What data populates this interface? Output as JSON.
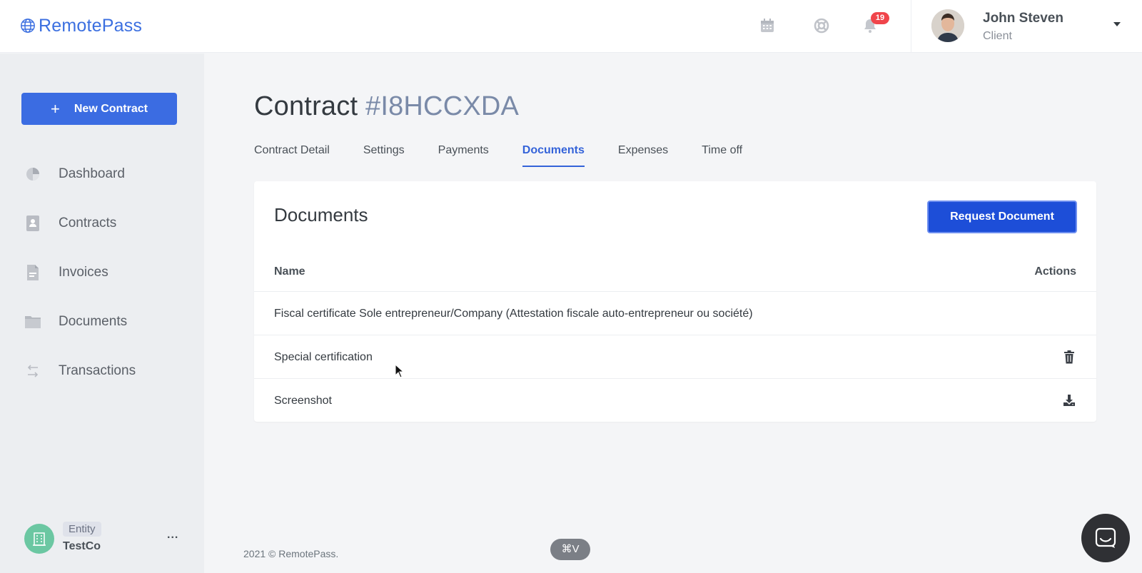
{
  "brand": {
    "name": "RemotePass",
    "color": "#3b6fe0"
  },
  "topbar": {
    "icons": [
      "calendar-icon",
      "support-icon",
      "bell-icon"
    ],
    "notification_count": "19",
    "user": {
      "name": "John Steven",
      "role": "Client"
    }
  },
  "sidebar": {
    "new_contract_label": "New Contract",
    "items": [
      {
        "label": "Dashboard",
        "icon": "pie-chart-icon"
      },
      {
        "label": "Contracts",
        "icon": "contract-icon"
      },
      {
        "label": "Invoices",
        "icon": "invoice-icon"
      },
      {
        "label": "Documents",
        "icon": "folder-icon"
      },
      {
        "label": "Transactions",
        "icon": "transfer-icon"
      }
    ],
    "entity": {
      "tag": "Entity",
      "name": "TestCo",
      "more": "..."
    }
  },
  "page": {
    "title_prefix": "Contract",
    "contract_id": "#I8HCCXDA",
    "tabs": [
      {
        "label": "Contract Detail"
      },
      {
        "label": "Settings"
      },
      {
        "label": "Payments"
      },
      {
        "label": "Documents",
        "active": true
      },
      {
        "label": "Expenses"
      },
      {
        "label": "Time off"
      }
    ]
  },
  "documents": {
    "title": "Documents",
    "request_button": "Request Document",
    "columns": {
      "name": "Name",
      "actions": "Actions"
    },
    "rows": [
      {
        "name": "Fiscal certificate Sole entrepreneur/Company (Attestation fiscale auto-entrepreneur ou société)",
        "action": ""
      },
      {
        "name": "Special certification",
        "action": "trash-icon"
      },
      {
        "name": "Screenshot",
        "action": "download-icon"
      }
    ]
  },
  "footer": {
    "text": "2021 © RemotePass."
  },
  "overlay": {
    "shortcut": "⌘V"
  },
  "colors": {
    "primary": "#3b6ce2",
    "accent_tab": "#3463d9",
    "badge": "#f0454b",
    "entity": "#6bc7a2"
  }
}
